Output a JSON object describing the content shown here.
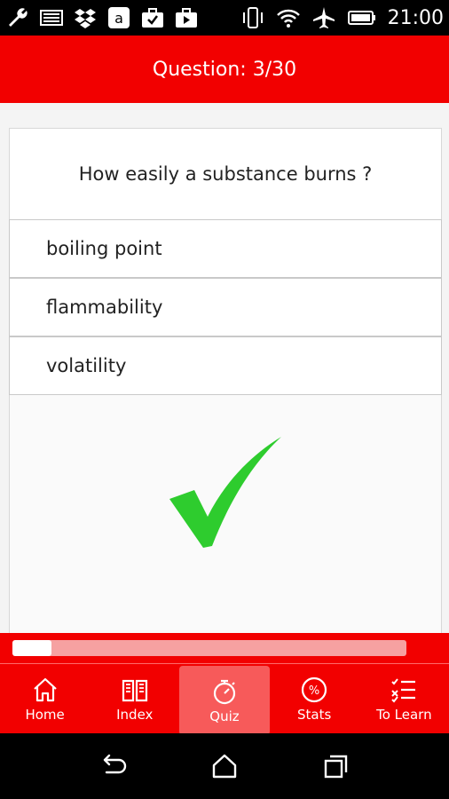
{
  "status_bar": {
    "time": "21:00",
    "left_icons": [
      "wrench-icon",
      "keyboard-icon",
      "dropbox-icon",
      "amazon-icon",
      "briefcase-check-icon",
      "briefcase-play-icon"
    ],
    "right_icons": [
      "vibrate-icon",
      "wifi-icon",
      "airplane-icon",
      "battery-icon"
    ]
  },
  "header": {
    "title": "Question: 3/30"
  },
  "quiz": {
    "question": "How easily a substance burns ?",
    "answers": [
      "boiling point",
      "flammability",
      "volatility"
    ],
    "result_icon": "checkmark-icon",
    "result_color": "#2ecc2e"
  },
  "progress": {
    "value": 0.1,
    "fill_color": "#ffffff"
  },
  "nav": {
    "items": [
      {
        "label": "Home",
        "icon": "home-icon"
      },
      {
        "label": "Index",
        "icon": "book-icon"
      },
      {
        "label": "Quiz",
        "icon": "stopwatch-icon",
        "active": true
      },
      {
        "label": "Stats",
        "icon": "percent-icon"
      },
      {
        "label": "To Learn",
        "icon": "checklist-icon"
      }
    ]
  },
  "system_nav": [
    "back-icon",
    "home-icon",
    "recents-icon"
  ],
  "colors": {
    "brand": "#f20000",
    "active_tab": "#f75a5a"
  }
}
